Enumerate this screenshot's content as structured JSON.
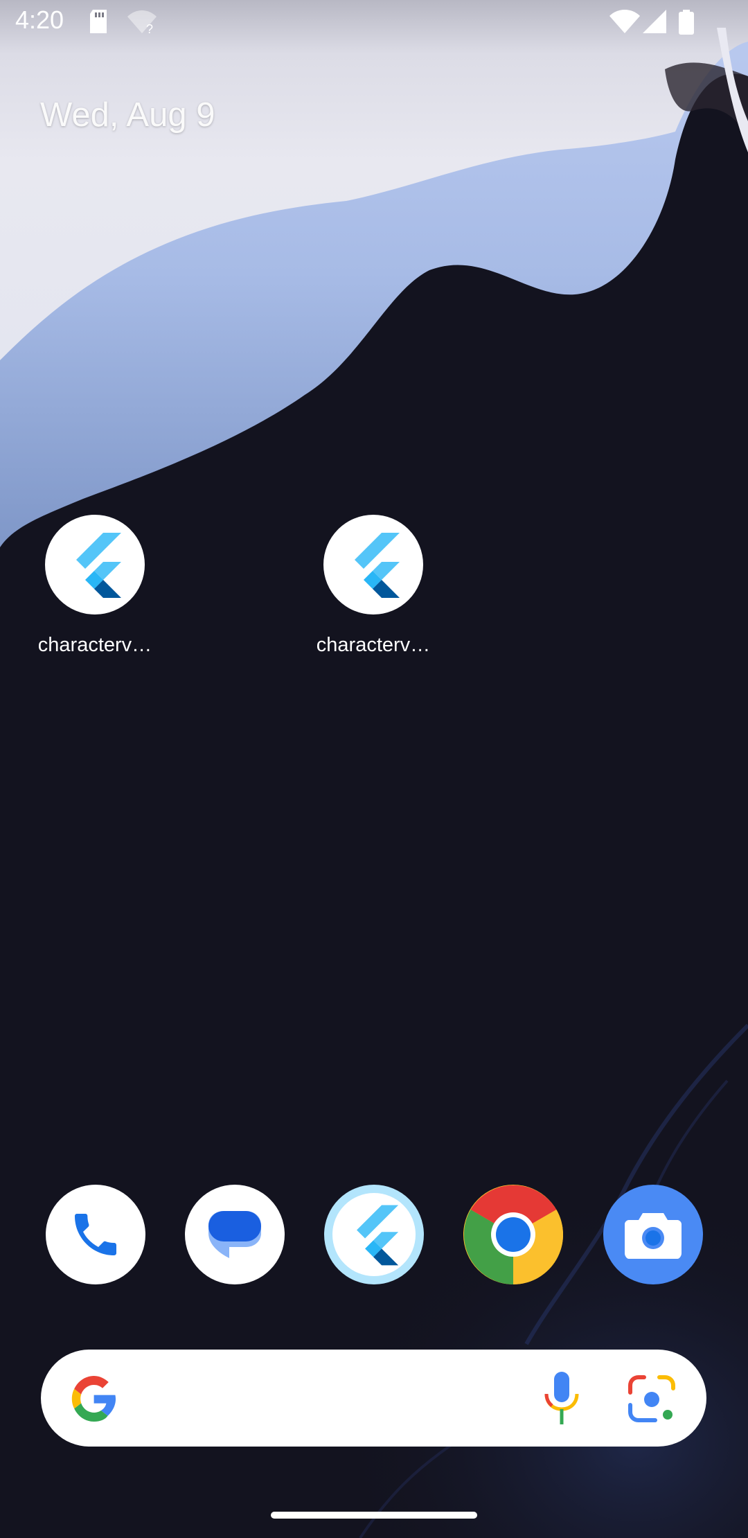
{
  "status_bar": {
    "time": "4:20",
    "icons": [
      "sd-card-icon",
      "wifi-unknown-icon",
      "wifi-icon",
      "cell-signal-icon",
      "battery-icon"
    ]
  },
  "home": {
    "date": "Wed, Aug 9",
    "apps": [
      {
        "label": "characterv…",
        "icon": "flutter-icon"
      },
      {
        "label": "characterv…",
        "icon": "flutter-icon"
      }
    ]
  },
  "dock": {
    "apps": [
      {
        "name": "phone-app",
        "icon": "phone-icon"
      },
      {
        "name": "messages-app",
        "icon": "messages-icon"
      },
      {
        "name": "flutter-app",
        "icon": "flutter-icon"
      },
      {
        "name": "chrome-app",
        "icon": "chrome-icon"
      },
      {
        "name": "camera-app",
        "icon": "camera-icon"
      }
    ]
  },
  "search": {
    "icons": [
      "google-icon",
      "microphone-icon",
      "google-lens-icon"
    ]
  },
  "colors": {
    "wallpaper_dark": "#13131f",
    "wallpaper_light": "#e6e6ef",
    "wallpaper_blue": "#a9bde6",
    "flutter_light": "#54c5f8",
    "flutter_dark": "#01579b",
    "phone_blue": "#1a73e8",
    "messages_blue": "#1a5fe0",
    "camera_blue": "#4a8af4"
  }
}
